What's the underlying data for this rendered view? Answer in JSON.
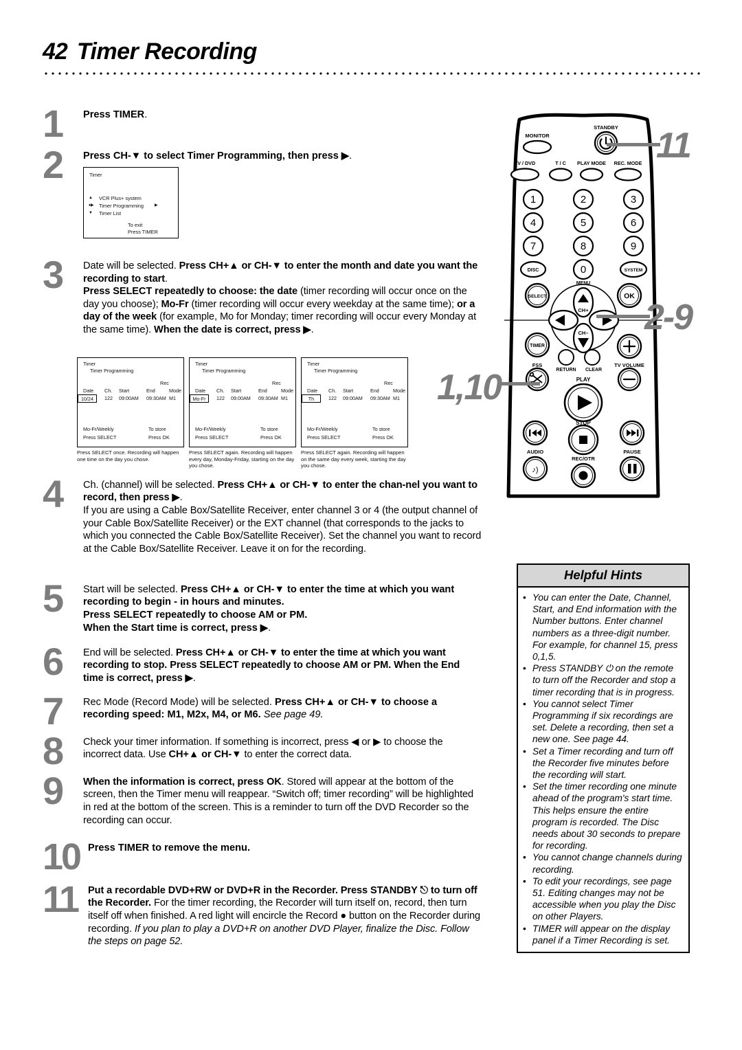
{
  "header": {
    "page_number": "42",
    "title": "Timer Recording"
  },
  "steps": [
    {
      "num": "1",
      "html": "<b>Press TIMER</b>."
    },
    {
      "num": "2",
      "html": "<b>Press CH-&#9660; to select Timer Programming, then press &#9654;</b>."
    },
    {
      "num": "3",
      "html": "Date will be selected. <b>Press CH+&#9650; or CH-&#9660; to enter the month and date you want the recording to start</b>.<br><b>Press SELECT repeatedly to choose: the date</b> (timer recording will occur once on the day you choose); <b>Mo-Fr</b> (timer recording will occur every weekday at the same time); <b>or a day of the week</b> (for example, Mo for Monday; timer recording will occur every Monday at the same time). <b>When the date is correct, press &#9654;</b>."
    },
    {
      "num": "4",
      "html": "Ch. (channel) will be selected. <b>Press CH+&#9650; or CH-&#9660; to enter the chan-nel you want to record, then press &#9654;</b>.<br>If you are using a Cable Box/Satellite Receiver, enter channel 3 or 4 (the output channel of your Cable Box/Satellite Receiver) or the EXT channel (that corresponds to the jacks to which you connected the Cable Box/Satellite Receiver). Set the channel you want to record at the Cable Box/Satellite Receiver. Leave it on for the recording."
    },
    {
      "num": "5",
      "html": "Start will be selected. <b>Press CH+&#9650; or CH-&#9660; to enter the time at which you want recording to begin - in hours and minutes.<br>Press SELECT repeatedly to choose AM or PM.<br>When the Start time is correct, press &#9654;</b>."
    },
    {
      "num": "6",
      "html": "End will be selected. <b>Press CH+&#9650; or CH-&#9660; to enter the time at which you want recording to stop. Press SELECT repeatedly to choose AM or PM. When the End time is correct, press &#9654;</b>."
    },
    {
      "num": "7",
      "html": "Rec Mode (Record Mode) will be selected. <b>Press CH+&#9650; or CH-&#9660; to choose a recording speed: M1, M2x, M4, or M6.</b> <i>See page 49.</i>"
    },
    {
      "num": "8",
      "html": "Check your timer information. If something is incorrect, press &#9664; or &#9654; to choose the incorrect data. Use <b>CH+&#9650; or CH-&#9660;</b> to enter the correct data."
    },
    {
      "num": "9",
      "html": "<b>When the information is correct, press OK</b>. Stored will appear at the bottom of the screen, then the Timer menu will reappear. &#8220;Switch off; timer recording&#8221; will be highlighted in red at the bottom of the screen. This is a reminder to turn off the DVD Recorder so the recording can occur."
    },
    {
      "num": "10",
      "html": "<b>Press TIMER to remove the menu.</b>"
    },
    {
      "num": "11",
      "html": "<b>Put a recordable DVD+RW or DVD+R in the Recorder. Press STANDBY &#9099; to turn off the Recorder.</b> For the timer recording, the Recorder will turn itself on, record, then turn itself off when finished. A red light will encircle the Record &#9679; button on the Recorder during recording. <i>If you plan to play a DVD+R on another DVD Player, finalize the Disc. Follow the steps on page 52.</i>"
    }
  ],
  "timer_menu": {
    "title": "Timer",
    "items": [
      {
        "arrow": "▲",
        "label": "VCR Plus+ system",
        "chevron": ""
      },
      {
        "arrow": "♦▶",
        "label": "Timer Programming",
        "chevron": "▶"
      },
      {
        "arrow": "▼",
        "label": "Timer List",
        "chevron": ""
      }
    ],
    "exit_line1": "To exit",
    "exit_line2": "Press TIMER"
  },
  "timer_panels": {
    "title": "Timer",
    "subtitle": "Timer Programming",
    "rec_label": "Rec",
    "columns": [
      "Date",
      "Ch.",
      "Start",
      "End",
      "Mode"
    ],
    "footer_left1": "Mo-Fr/Weekly",
    "footer_left2": "Press SELECT",
    "footer_right1": "To store",
    "footer_right2": "Press OK",
    "items": [
      {
        "date": "10/24",
        "ch": "122",
        "start": "09:00AM",
        "end": "09:30AM",
        "mode": "M1",
        "caption": "Press SELECT once. Recording will happen one time on the day you chose."
      },
      {
        "date": "Mo-Fr",
        "ch": "122",
        "start": "09:00AM",
        "end": "09:30AM",
        "mode": "M1",
        "caption": "Press SELECT again. Recording will happen every day, Monday-Friday, starting on the day you chose."
      },
      {
        "date": "Th",
        "ch": "122",
        "start": "09:00AM",
        "end": "09:30AM",
        "mode": "M1",
        "caption": "Press SELECT again. Recording will happen on the same day every week, starting the day you chose."
      }
    ]
  },
  "remote": {
    "labels": {
      "standby": "STANDBY",
      "monitor": "MONITOR",
      "tv_dvd": "TV / DVD",
      "t_c": "T / C",
      "play_mode": "PLAY MODE",
      "rec_mode": "REC. MODE",
      "disc": "DISC",
      "system": "SYSTEM",
      "menu": "MENU",
      "select": "SELECT",
      "ok": "OK",
      "ch_plus": "CH+",
      "ch_minus": "CH−",
      "timer": "TIMER",
      "fss": "FSS",
      "return": "RETURN",
      "clear": "CLEAR",
      "tv_volume": "TV VOLUME",
      "play": "PLAY",
      "stop": "STOP",
      "audio": "AUDIO",
      "rec_otr": "REC/OTR",
      "pause": "PAUSE"
    },
    "numbers": [
      "1",
      "2",
      "3",
      "4",
      "5",
      "6",
      "7",
      "8",
      "9",
      "0"
    ]
  },
  "callouts": [
    {
      "text": "11",
      "name": "callout-11"
    },
    {
      "text": "2-9",
      "name": "callout-2-9"
    },
    {
      "text": "1,10",
      "name": "callout-1-10"
    }
  ],
  "helpful_hints": {
    "heading": "Helpful Hints",
    "bullet": "•",
    "items": [
      "You can enter the Date, Channel, Start, and End information with the Number buttons. Enter channel numbers as a three-digit number. For example, for channel 15, press 0,1,5.",
      "Press STANDBY ⏻ on the remote to turn off the Recorder and stop a timer recording that is in progress.",
      "You cannot select Timer Programming if six recordings are set. Delete a recording, then set a new one. See page 44.",
      "Set a Timer recording and turn off the Recorder five minutes before the recording will start.",
      "Set the timer recording one minute ahead of the program's start time. This helps ensure the entire program is recorded. The Disc needs about 30 seconds to prepare for recording.",
      "You cannot change channels during recording.",
      "To edit your recordings, see page 51. Editing changes may not be accessible when you play the Disc on other Players.",
      "TIMER will appear on the display panel if a Timer Recording is set."
    ]
  },
  "colors": {
    "step_number_gray": "#7d7d7d",
    "hints_header_bg": "#d6d6d6",
    "text": "#000000"
  }
}
